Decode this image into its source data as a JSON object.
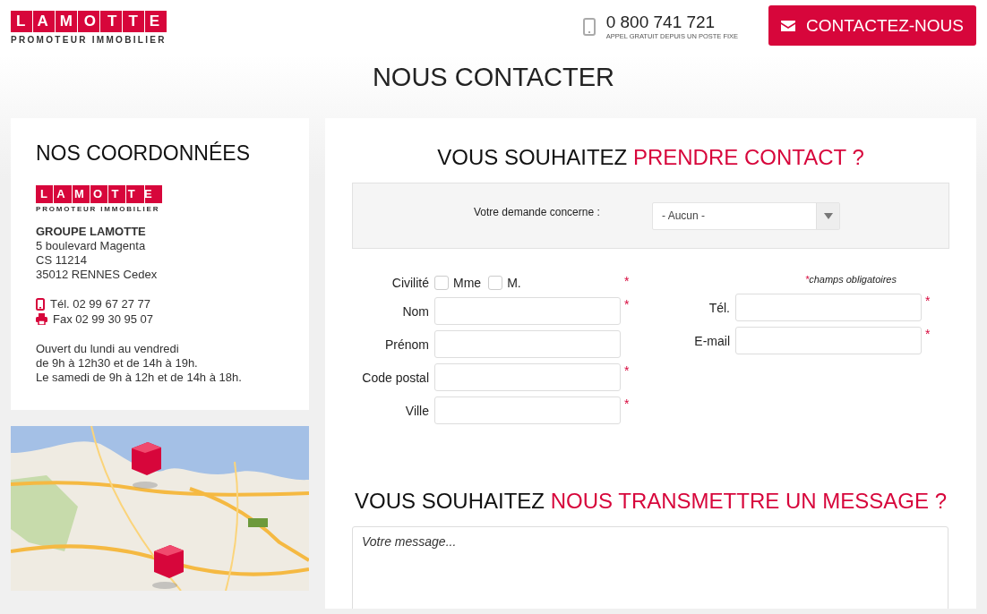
{
  "header": {
    "logo": {
      "name": "LAMOTTE",
      "tagline": "PROMOTEUR IMMOBILIER"
    },
    "phone": {
      "number": "0 800 741 721",
      "note": "APPEL GRATUIT DEPUIS UN POSTE FIXE"
    },
    "contact_button": "CONTACTEZ-NOUS"
  },
  "page_title": "NOUS CONTACTER",
  "coordinates": {
    "title": "NOS COORDONNÉES",
    "logo": {
      "name": "LAMOTTE",
      "tagline": "PROMOTEUR IMMOBILIER"
    },
    "company": "GROUPE LAMOTTE",
    "address": [
      "5 boulevard Magenta",
      "CS 11214",
      "35012 RENNES Cedex"
    ],
    "contacts": [
      {
        "kind": "phone",
        "text": "Tél. 02 99 67 27 77"
      },
      {
        "kind": "fax",
        "text": "Fax 02 99 30 95 07"
      }
    ],
    "hours": [
      "Ouvert du lundi au vendredi",
      "de 9h à 12h30 et de 14h à 19h.",
      "Le samedi de 9h à 12h et de 14h à 18h."
    ]
  },
  "contact_form": {
    "heading": {
      "lead": "VOUS SOUHAITEZ",
      "highlight": "PRENDRE CONTACT ?"
    },
    "request": {
      "label": "Votre demande concerne :",
      "value": "- Aucun -"
    },
    "required_note": {
      "mark": "*",
      "text": "champs obligatoires"
    },
    "civility": {
      "label": "Civilité",
      "required": true,
      "options": [
        {
          "label": "Mme",
          "checked": false
        },
        {
          "label": "M.",
          "checked": false
        }
      ]
    },
    "left_fields": [
      {
        "label": "Nom",
        "required": true
      },
      {
        "label": "Prénom",
        "required": false
      },
      {
        "label": "Code postal",
        "required": true
      },
      {
        "label": "Ville",
        "required": true
      }
    ],
    "right_fields": [
      {
        "label": "Tél.",
        "required": true
      },
      {
        "label": "E-mail",
        "required": true
      }
    ]
  },
  "message": {
    "heading": {
      "lead": "VOUS SOUHAITEZ",
      "highlight": "NOUS TRANSMETTRE UN MESSAGE ?"
    },
    "placeholder": "Votre message..."
  }
}
